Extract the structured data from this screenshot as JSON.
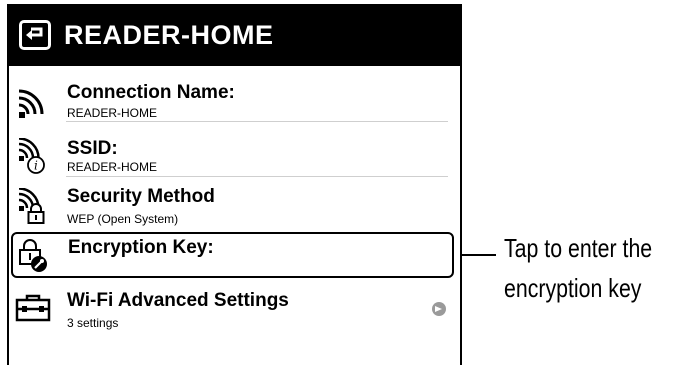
{
  "title_bar": {
    "title": "READER-HOME",
    "back_icon": "back-return-icon"
  },
  "settings": [
    {
      "label": "Connection Name:",
      "value": "READER-HOME",
      "icon": "wifi-signal-icon"
    },
    {
      "label": "SSID:",
      "value": "READER-HOME",
      "icon": "wifi-info-icon"
    },
    {
      "label": "Security Method",
      "value": "WEP (Open System)",
      "icon": "wifi-lock-icon"
    },
    {
      "label": "Encryption Key:",
      "value": "",
      "icon": "lock-key-icon"
    },
    {
      "label": "Wi-Fi Advanced Settings",
      "value": "3 settings",
      "icon": "toolbox-icon"
    }
  ],
  "callout": {
    "line1": "Tap to enter the",
    "line2": "encryption key"
  }
}
